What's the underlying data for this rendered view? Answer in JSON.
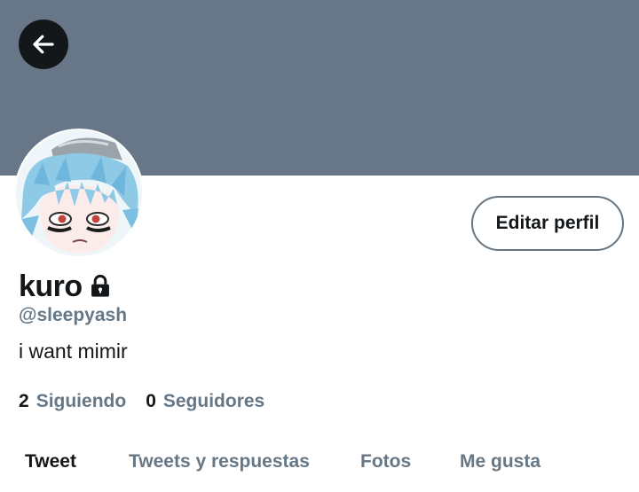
{
  "profile": {
    "display_name": "kuro",
    "handle": "@sleepyash",
    "bio": "i want mimir",
    "locked": true
  },
  "actions": {
    "back_icon": "arrow-left-icon",
    "edit_profile_label": "Editar perfil"
  },
  "stats": {
    "following_count": "2",
    "following_label": "Siguiendo",
    "followers_count": "0",
    "followers_label": "Seguidores"
  },
  "tabs": [
    {
      "label": "Tweet",
      "active": true
    },
    {
      "label": "Tweets y respuestas",
      "active": false
    },
    {
      "label": "Fotos",
      "active": false
    },
    {
      "label": "Me gusta",
      "active": false
    }
  ],
  "colors": {
    "banner": "#677787",
    "primary_text": "#14171a",
    "secondary_text": "#667786",
    "background": "#ffffff"
  }
}
